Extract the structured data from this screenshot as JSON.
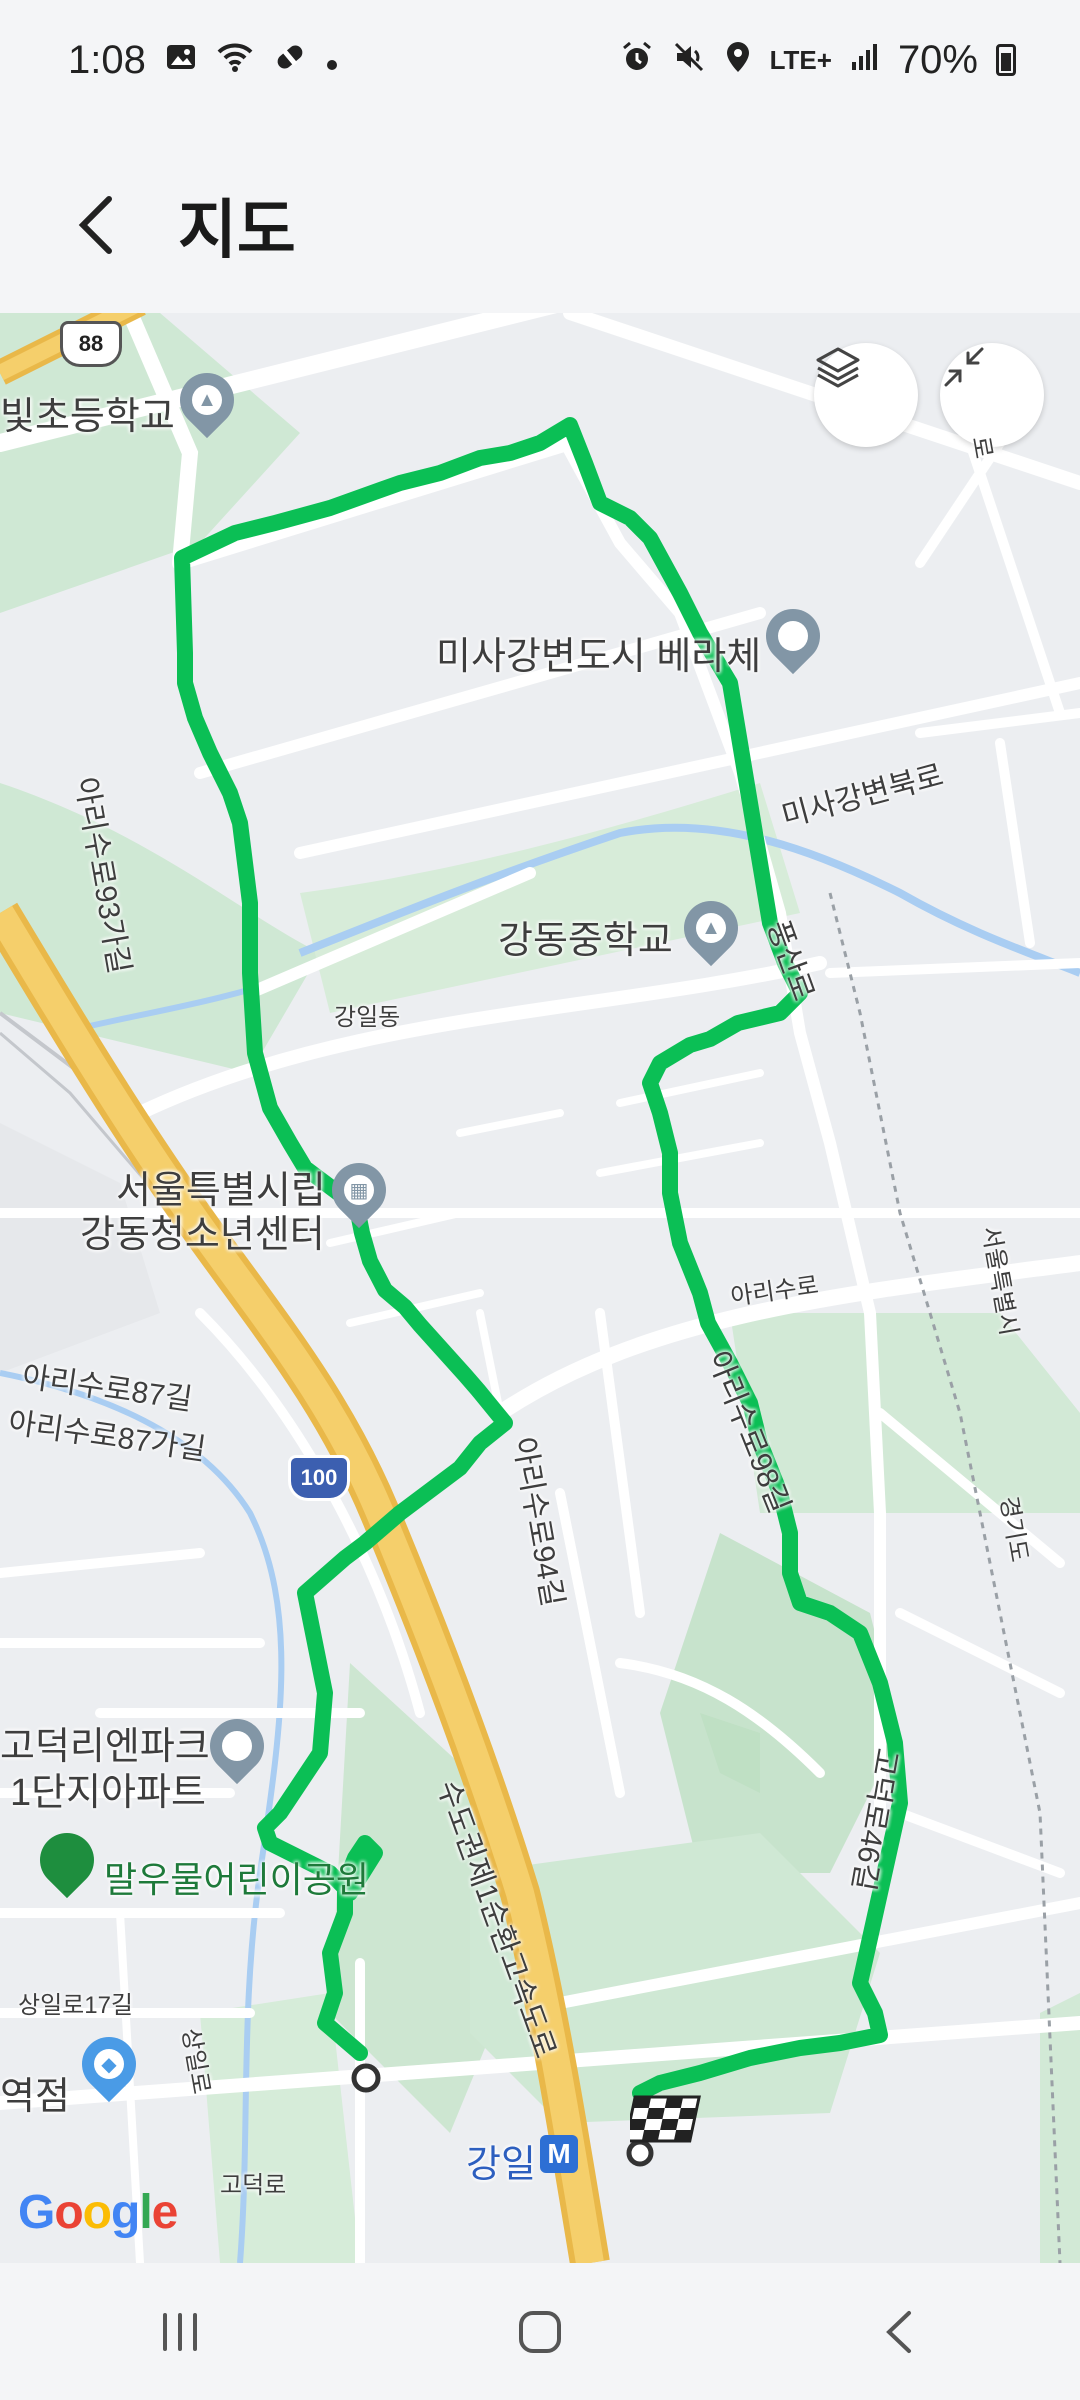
{
  "status_bar": {
    "time": "1:08",
    "network": "LTE+",
    "battery": "70%",
    "icons": [
      "image-icon",
      "wifi-icon",
      "link-icon",
      "dot-icon",
      "alarm-icon",
      "mute-icon",
      "location-icon",
      "signal-icon",
      "battery-icon"
    ]
  },
  "header": {
    "back_icon": "chevron-left-icon",
    "title": "지도"
  },
  "map": {
    "labels": {
      "school_top": "빛초등학교",
      "beracher": "미사강변도시 베라체",
      "road_93": "아리수로93가길",
      "misa_bukro": "미사강변북로",
      "gangdong_middle": "강동중학교",
      "pungsan": "풍산로",
      "gangil_dong": "강일동",
      "youth_center_1": "서울특별시립",
      "youth_center_2": "강동청소년센터",
      "arisu_ro": "아리수로",
      "seoul_city": "서울특별시",
      "road_87": "아리수로87길",
      "road_87ga": "아리수로87가길",
      "road_98": "아리수로98길",
      "road_94": "아리수로94길",
      "gyeonggi": "경기도",
      "godeok_park_1": "고덕리엔파크",
      "godeok_park_2": "1단지아파트",
      "kids_park": "말우물어린이공원",
      "expressway": "수도권제1순환고속도로",
      "road_46": "고덕로46길",
      "sangil_17": "상일로17길",
      "sangil_ro": "상일로",
      "station_edge": "역점",
      "gangil": "강일",
      "godeok_ro": "고덕로",
      "ro_edge": "로"
    },
    "shields": {
      "route_88": "88",
      "route_100": "100"
    },
    "metro_symbol": "M",
    "google": [
      "G",
      "o",
      "o",
      "g",
      "l",
      "e"
    ],
    "controls": {
      "layers_icon": "layers-icon",
      "collapse_icon": "collapse-icon"
    },
    "route_color": "#0bbf55"
  },
  "nav_bar": {
    "recent_icon": "recent-apps-icon",
    "home_icon": "home-icon",
    "back_icon": "back-icon"
  }
}
